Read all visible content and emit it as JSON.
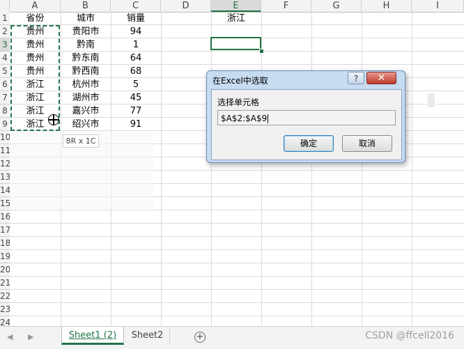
{
  "columns": [
    "A",
    "B",
    "C",
    "D",
    "E",
    "F",
    "G",
    "H",
    "I"
  ],
  "active_column": "E",
  "rows": [
    "1",
    "2",
    "3",
    "4",
    "5",
    "6",
    "7",
    "8",
    "9",
    "10",
    "11",
    "12",
    "13",
    "14",
    "15",
    "16",
    "17",
    "18",
    "19",
    "20",
    "21",
    "22",
    "23",
    "24"
  ],
  "table": {
    "headers": [
      "省份",
      "城市",
      "销量"
    ],
    "data": [
      [
        "贵州",
        "贵阳市",
        "94"
      ],
      [
        "贵州",
        "黔南",
        "1"
      ],
      [
        "贵州",
        "黔东南",
        "64"
      ],
      [
        "贵州",
        "黔西南",
        "68"
      ],
      [
        "浙江",
        "杭州市",
        "5"
      ],
      [
        "浙江",
        "湖州市",
        "45"
      ],
      [
        "浙江",
        "嘉兴市",
        "77"
      ],
      [
        "浙江",
        "绍兴市",
        "91"
      ]
    ]
  },
  "cell_e1": "浙江",
  "tooltip": "8R x 1C",
  "dialog": {
    "title": "在Excel中选取",
    "help": "?",
    "close": "✕",
    "label": "选择单元格",
    "value": "$A$2:$A$9",
    "ok": "确定",
    "cancel": "取消"
  },
  "tabs": {
    "sheet1": "Sheet1 (2)",
    "sheet2": "Sheet2",
    "add": "+"
  },
  "nav": {
    "prev": "◀",
    "next": "▶"
  },
  "watermark": "CSDN @ffcell2016",
  "colors": {
    "accent": "#217346",
    "dialog_frame": "#c7dbf1",
    "close_button": "#c0392b"
  }
}
